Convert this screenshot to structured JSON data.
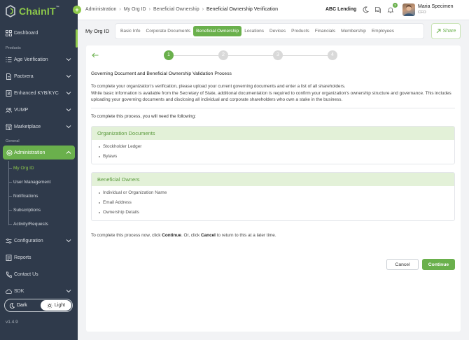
{
  "brand": {
    "name": "ChainIT",
    "tm": "™",
    "accent": "#6ab04c"
  },
  "sidebar": {
    "section_products": "Products",
    "section_general": "General",
    "items": [
      {
        "label": "Dashboard",
        "icon": "grid-icon"
      },
      {
        "label": "Age Verification",
        "icon": "list-icon"
      },
      {
        "label": "Pactvera",
        "icon": "document-icon"
      },
      {
        "label": "Enhanced KYB/KYC",
        "icon": "id-card-icon"
      },
      {
        "label": "VUMP",
        "icon": "users-icon"
      },
      {
        "label": "Marketplace",
        "icon": "store-icon"
      },
      {
        "label": "Administration",
        "icon": "settings-icon"
      },
      {
        "label": "Configuration",
        "icon": "sliders-icon"
      },
      {
        "label": "Reports",
        "icon": "report-icon"
      },
      {
        "label": "Contact Us",
        "icon": "phone-icon"
      },
      {
        "label": "SDK",
        "icon": "cloud-icon"
      }
    ],
    "admin_sub": [
      "My Org ID",
      "User Management",
      "Notifications",
      "Subscriptions",
      "Activity/Requests"
    ],
    "theme": {
      "dark": "Dark",
      "light": "Light"
    },
    "version": "v1.4.9"
  },
  "header": {
    "breadcrumb": [
      "Administration",
      "My Org ID",
      "Beneficial Ownership",
      "Beneficial Ownership Verification"
    ],
    "org": "ABC Lending",
    "notif_count": "2",
    "user_name": "Maria Specimen",
    "user_role": "CFO"
  },
  "tabs_bar": {
    "title": "My Org ID",
    "tabs": [
      "Basic Info",
      "Corporate Documents",
      "Beneficial Ownership",
      "Locations",
      "Devices",
      "Products",
      "Financials",
      "Membership",
      "Employees"
    ],
    "share": "Share"
  },
  "main": {
    "steps": [
      "1",
      "2",
      "3",
      "4"
    ],
    "current_step": 1,
    "title": "Governing Document and Beneficial Ownership Validation Process",
    "intro_1": "To complete your organization's verification, please upload your current governing documents and enter a list of all shareholders.",
    "intro_2": "While basic information is available from the Secretary of State, additional documentation is required to confirm your organization's ownership structure and governance. This includes uploading your governing documents and disclosing all individual and corporate shareholders who own a stake in the business.",
    "need": "To complete this process, you will need the following:",
    "org_docs": {
      "title": "Organization Documents",
      "items": [
        "Stockholder Ledger",
        "Bylaws"
      ]
    },
    "owners": {
      "title": "Beneficial Owners",
      "items": [
        "Individual or Organization Name",
        "Email Address",
        "Ownership Details"
      ]
    },
    "foot_pre": "To complete this process now, click ",
    "foot_continue": "Continue",
    "foot_mid": ". Or, click ",
    "foot_cancel": "Cancel",
    "foot_post": " to return to this at a later time.",
    "cancel_label": "Cancel",
    "continue_label": "Continue"
  }
}
